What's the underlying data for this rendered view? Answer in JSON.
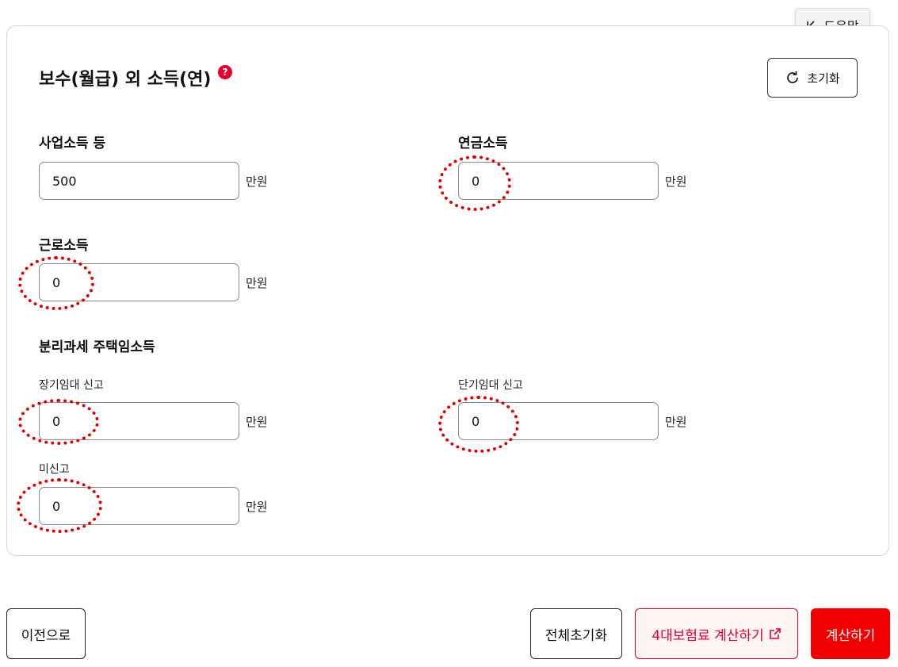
{
  "help": {
    "label": "도움말"
  },
  "section": {
    "title": "보수(월급) 외 소득(연)",
    "help_mark": "?",
    "reset_label": "초기화"
  },
  "fields": {
    "business": {
      "label": "사업소득 등",
      "value": "500",
      "unit": "만원"
    },
    "pension": {
      "label": "연금소득",
      "value": "0",
      "unit": "만원"
    },
    "earned": {
      "label": "근로소득",
      "value": "0",
      "unit": "만원"
    }
  },
  "housing": {
    "heading": "분리과세 주택임소득",
    "long_term": {
      "label": "장기임대 신고",
      "value": "0",
      "unit": "만원"
    },
    "short_term": {
      "label": "단기임대 신고",
      "value": "0",
      "unit": "만원"
    },
    "unreported": {
      "label": "미신고",
      "value": "0",
      "unit": "만원"
    }
  },
  "footer": {
    "prev_label": "이전으로",
    "reset_all_label": "전체초기화",
    "insurance_label": "4대보험료 계산하기",
    "calculate_label": "계산하기"
  },
  "colors": {
    "accent": "#e4002b",
    "primary_button": "#f00000",
    "annotation": "#e00000"
  }
}
